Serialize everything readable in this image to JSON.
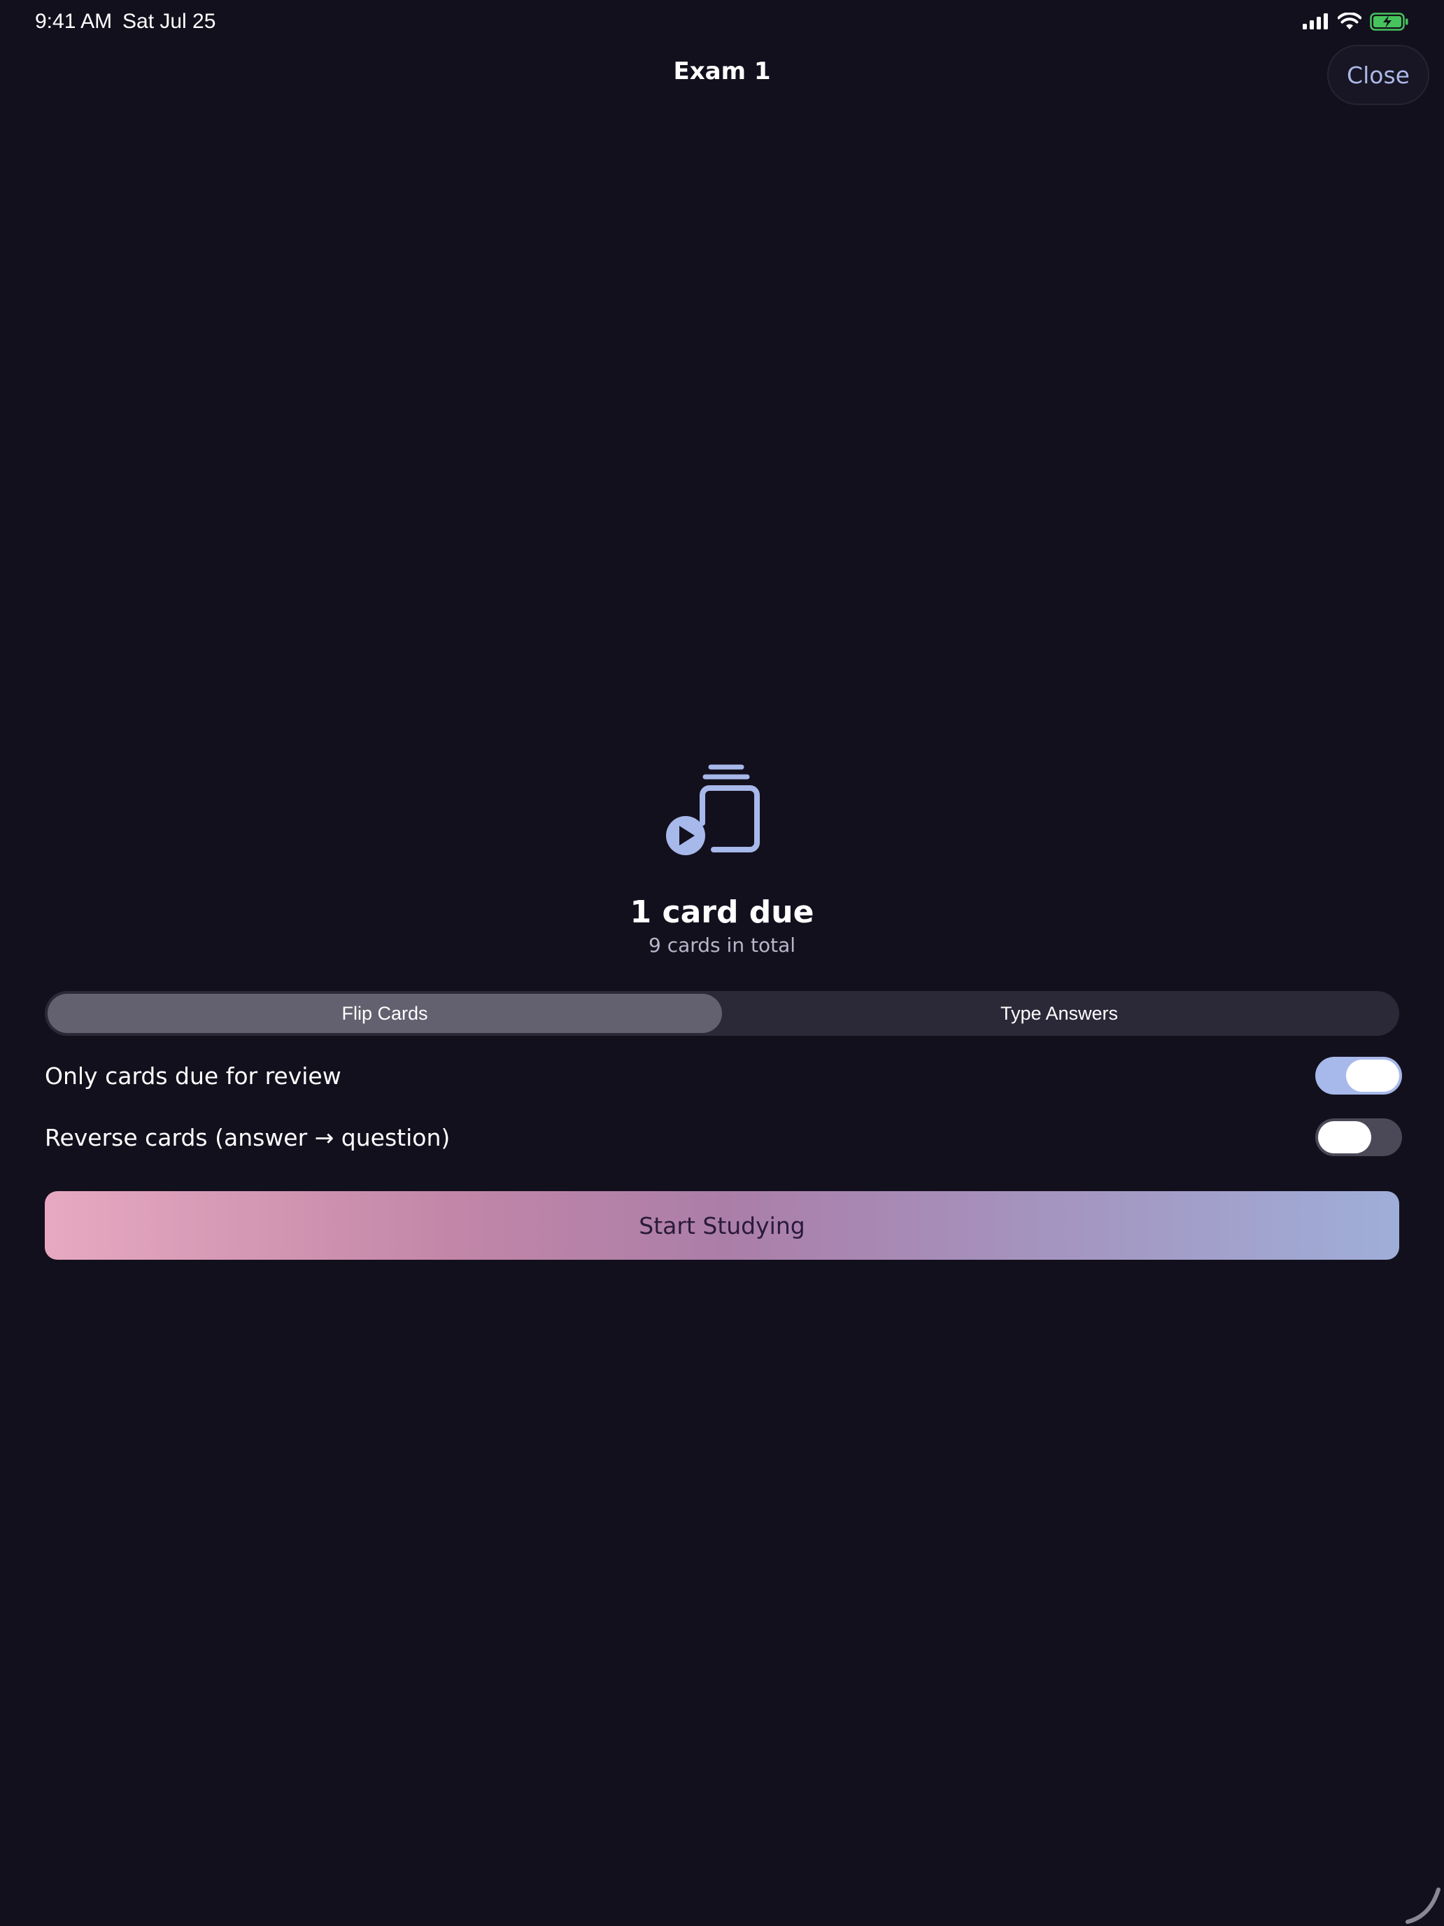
{
  "status_bar": {
    "time": "9:41 AM",
    "date": "Sat Jul 25",
    "icons": [
      "cellular-signal-icon",
      "wifi-icon",
      "battery-charging-icon"
    ]
  },
  "nav": {
    "title": "Exam 1",
    "close_label": "Close"
  },
  "deck": {
    "icon": "study-deck-play-icon",
    "due_label": "1 card due",
    "total_label": "9 cards in total"
  },
  "mode": {
    "options": [
      "Flip Cards",
      "Type Answers"
    ],
    "selected": "Flip Cards"
  },
  "options": {
    "only_due": {
      "label": "Only cards due for review",
      "enabled": true
    },
    "reverse": {
      "label": "Reverse cards (answer → question)",
      "enabled": false
    }
  },
  "start_label": "Start Studying",
  "colors": {
    "background": "#13101d",
    "accent": "#a7b8ea",
    "gradient_start": "#e7a9c0",
    "gradient_end": "#9faed8"
  }
}
